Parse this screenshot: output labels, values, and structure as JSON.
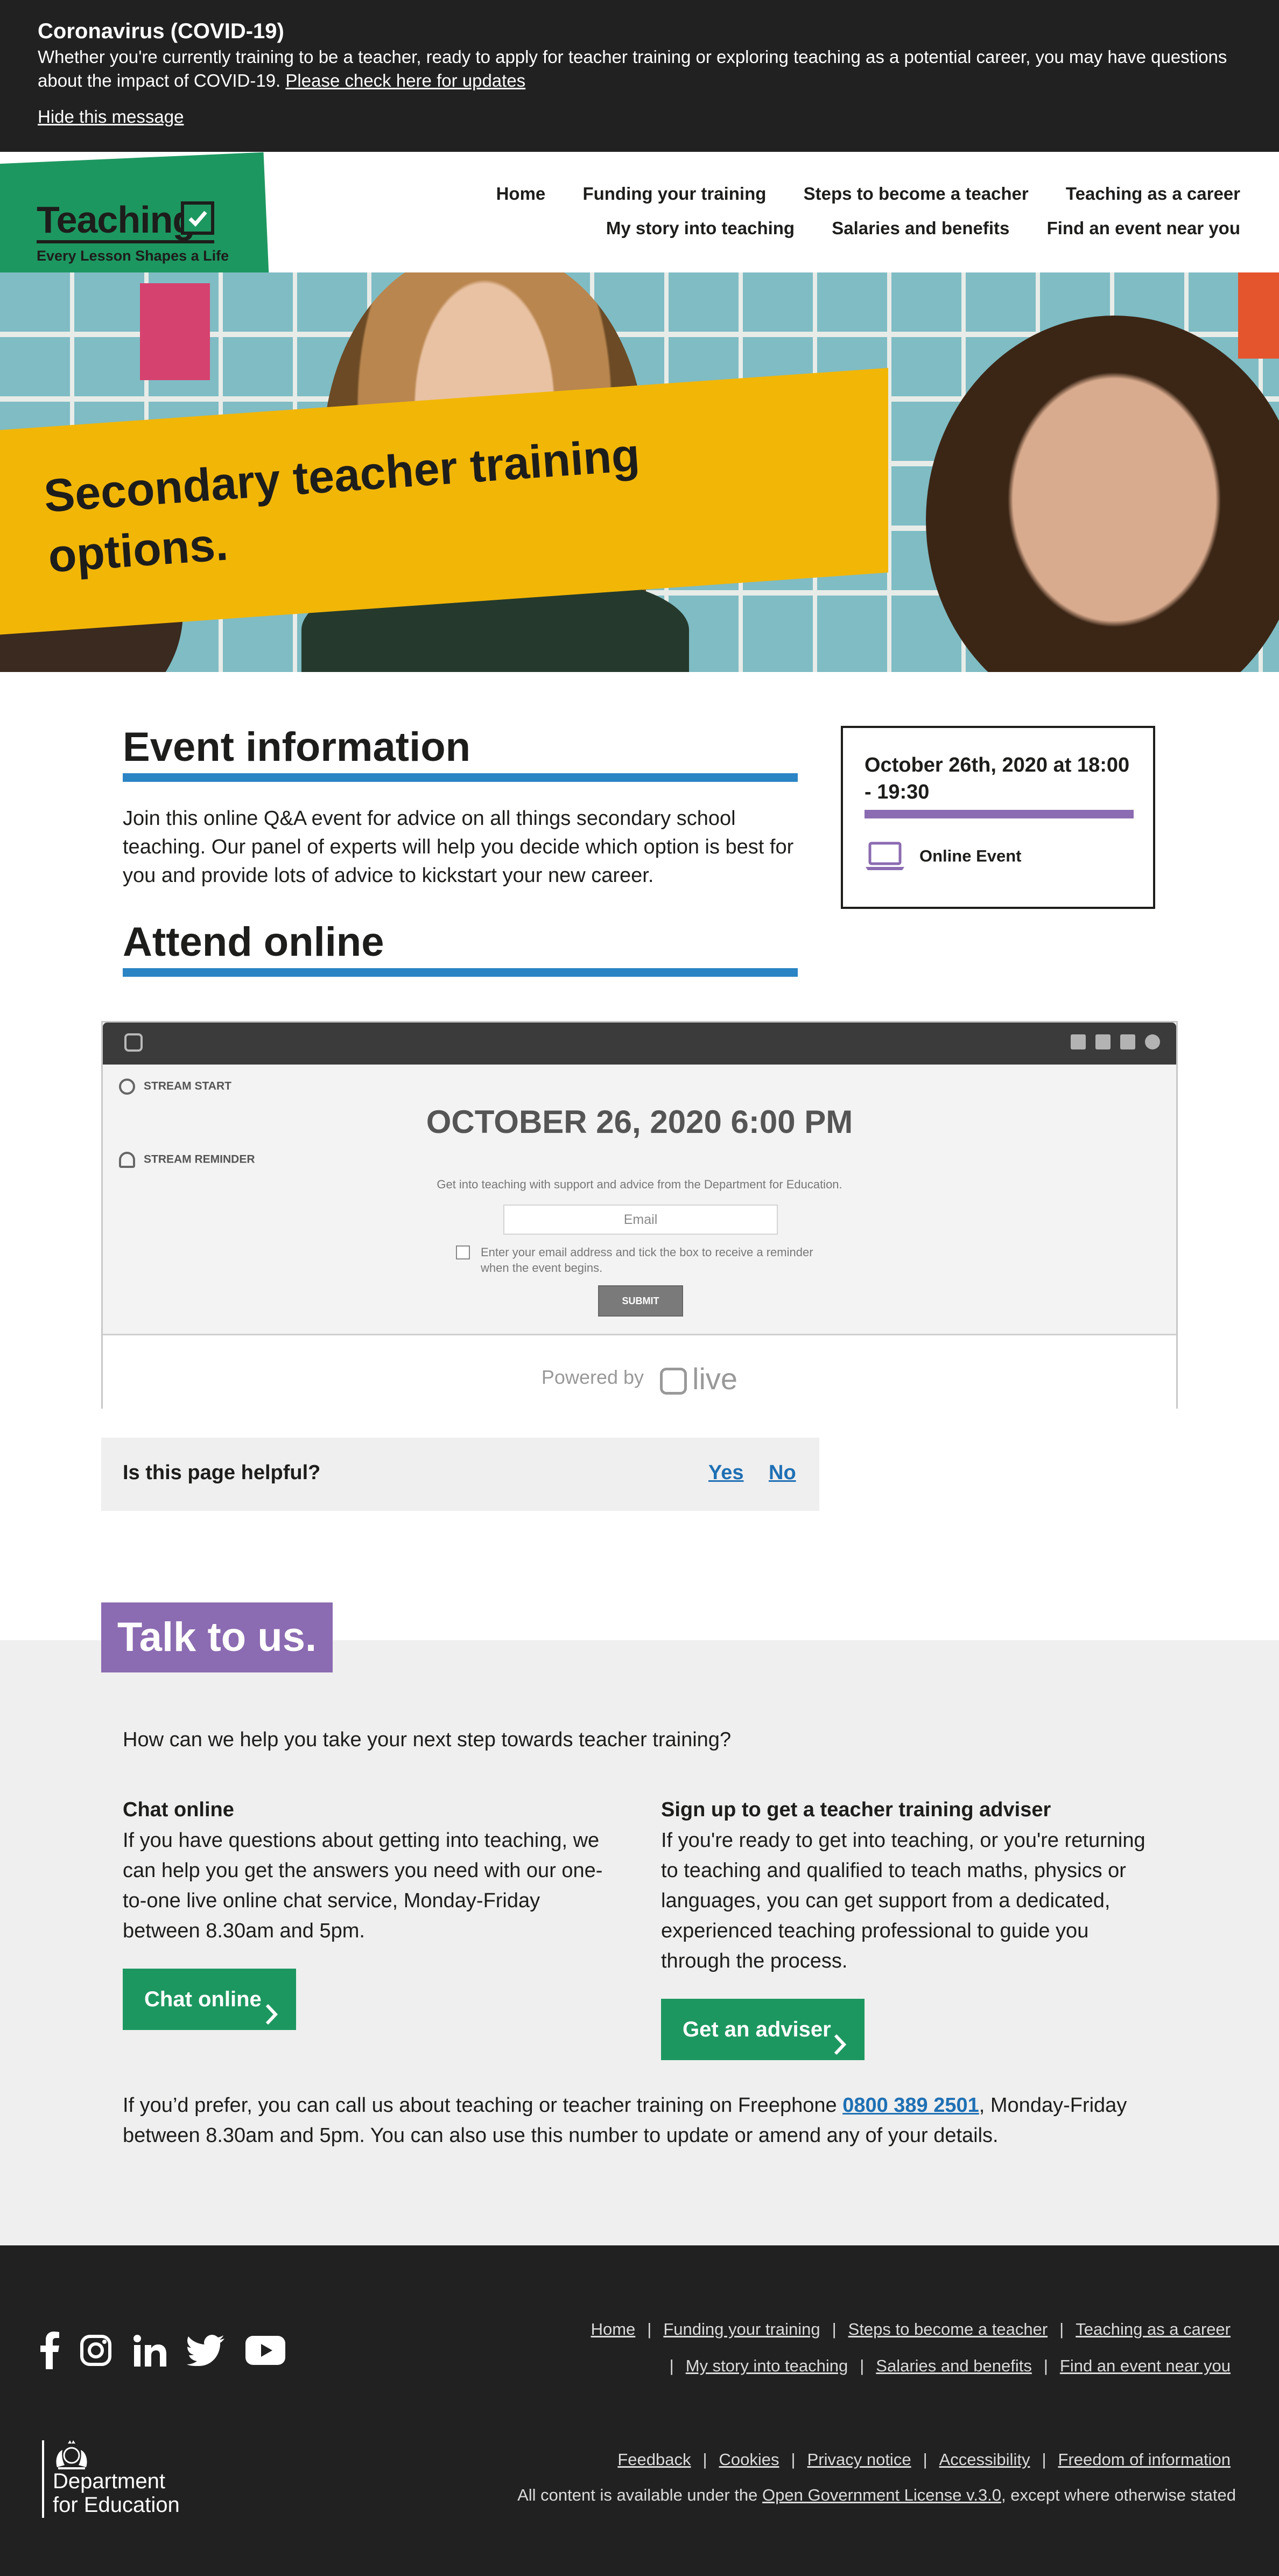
{
  "covid": {
    "title": "Coronavirus (COVID-19)",
    "message": "Whether you're currently training to be a teacher, ready to apply for teacher training or exploring teaching as a potential career, you may have questions about the impact of COVID-19.",
    "link": "Please check here for updates",
    "hide": "Hide this message"
  },
  "logo": {
    "word": "Teaching",
    "tagline": "Every Lesson Shapes a Life"
  },
  "nav": {
    "row1": [
      "Home",
      "Funding your training",
      "Steps to become a teacher",
      "Teaching as a career"
    ],
    "row2": [
      "My story into teaching",
      "Salaries and benefits",
      "Find an event near you"
    ]
  },
  "hero": {
    "title": "Secondary teacher training options."
  },
  "event": {
    "heading": "Event information",
    "intro": "Join this online Q&A event for advice on all things secondary school teaching. Our panel of experts will help you decide which option is best for you and provide lots of advice to kickstart your new career.",
    "attend_heading": "Attend online",
    "card_date": "October 26th, 2020 at 18:00 - 19:30",
    "card_type": "Online Event"
  },
  "widget": {
    "stream_start": "STREAM START",
    "stream_reminder": "STREAM REMINDER",
    "date": "OCTOBER 26, 2020 6:00 PM",
    "description": "Get into teaching with support and advice from the Department for Education.",
    "email_placeholder": "Email",
    "checkbox_text": "Enter your email address and tick the box to receive a reminder when the event begins.",
    "submit": "SUBMIT",
    "powered_by": "Powered by",
    "brand": "live"
  },
  "helpful": {
    "question": "Is this page helpful?",
    "yes": "Yes",
    "no": "No"
  },
  "talk": {
    "tag": "Talk to us.",
    "question": "How can we help you take your next step towards teacher training?",
    "chat": {
      "heading": "Chat online",
      "text": "If you have questions about getting into teaching, we can help you get the answers you need with our one-to-one live online chat service, Monday-Friday between 8.30am and 5pm.",
      "button": "Chat online"
    },
    "adviser": {
      "heading": "Sign up to get a teacher training adviser",
      "text": "If you're ready to get into teaching, or you're returning to teaching and qualified to teach maths, physics or languages, you can get support from a dedicated, experienced teaching professional to guide you through the process.",
      "button": "Get an adviser"
    },
    "phone_before": "If you’d prefer, you can call us about teaching or teacher training on Freephone ",
    "phone_number": "0800 389 2501",
    "phone_after": ", Monday-Friday between 8.30am and 5pm. You can also use this number to update or amend any of your details."
  },
  "footer": {
    "social_icons": [
      "facebook-icon",
      "instagram-icon",
      "linkedin-icon",
      "twitter-icon",
      "youtube-icon"
    ],
    "nav_row1": [
      "Home",
      "Funding your training",
      "Steps to become a teacher",
      "Teaching as a career"
    ],
    "nav_row2": [
      "My story into teaching",
      "Salaries and benefits",
      "Find an event near you"
    ],
    "legal": [
      "Feedback",
      "Cookies",
      "Privacy notice",
      "Accessibility",
      "Freedom of information"
    ],
    "dfe_line1": "Department",
    "dfe_line2": "for Education",
    "license_before": "All content is available under the ",
    "license_link": "Open Government License v.3.0",
    "license_after": ", except where otherwise stated"
  },
  "colors": {
    "green": "#1d9760",
    "yellow": "#f2b607",
    "blue_bar": "#2b84c4",
    "purple": "#8b6bb1",
    "link_blue": "#1f70b4",
    "dark": "#212121"
  }
}
